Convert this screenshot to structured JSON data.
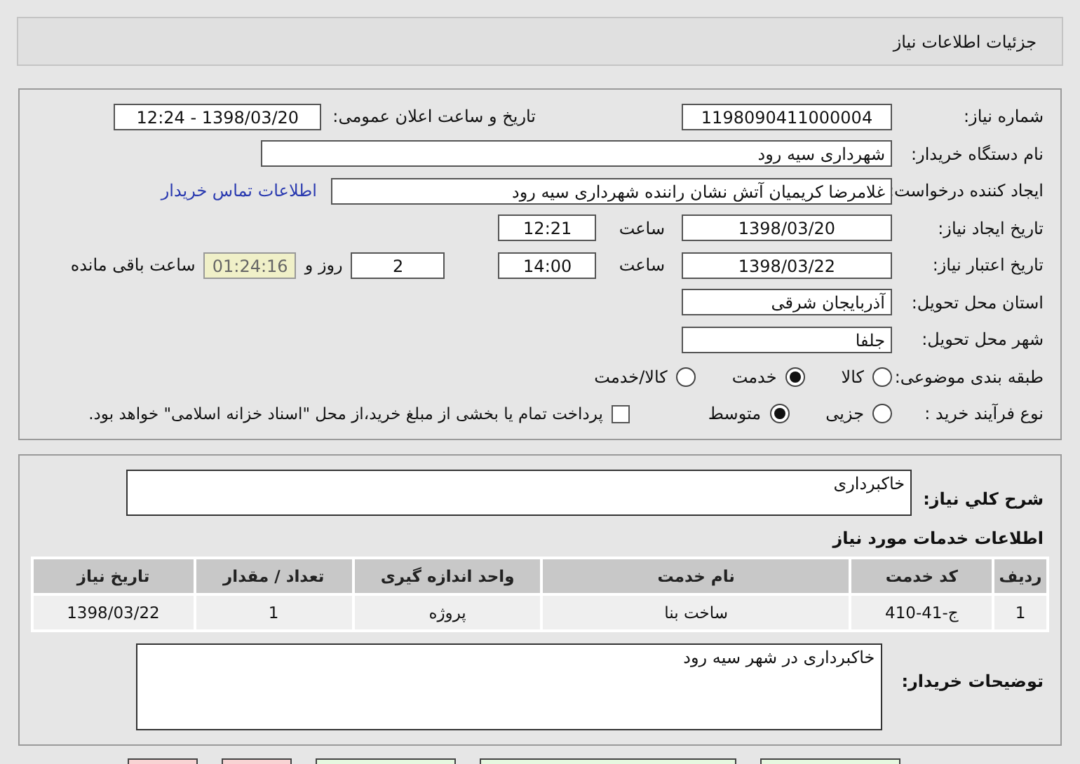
{
  "header": {
    "title": "جزئیات اطلاعات نیاز"
  },
  "need_info": {
    "need_number": {
      "label": "شماره نیاز:",
      "value": "1198090411000004"
    },
    "announce": {
      "label": "تاریخ و ساعت اعلان عمومی:",
      "value": "1398/03/20 - 12:24"
    },
    "buyer": {
      "label": "نام دستگاه خریدار:",
      "value": "شهرداری سیه رود"
    },
    "creator": {
      "label": "ایجاد کننده درخواست:",
      "value": "غلامرضا کریمیان آتش نشان راننده شهرداری سیه رود",
      "contact_link": "اطلاعات تماس خریدار"
    },
    "created": {
      "label": "تاریخ ایجاد نیاز:",
      "date": "1398/03/20",
      "time_label": "ساعت",
      "time": "12:21"
    },
    "validity": {
      "label": "تاریخ اعتبار نیاز:",
      "date": "1398/03/22",
      "time_label": "ساعت",
      "time": "14:00",
      "days": "2",
      "days_label": "روز و",
      "remaining": "01:24:16",
      "remaining_label": "ساعت باقی مانده"
    },
    "province": {
      "label": "استان محل تحویل:",
      "value": "آذربایجان شرقی"
    },
    "city": {
      "label": "شهر محل تحویل:",
      "value": "جلفا"
    },
    "category": {
      "label": "طبقه بندی موضوعی:",
      "options": [
        {
          "label": "کالا",
          "selected": false
        },
        {
          "label": "خدمت",
          "selected": true
        },
        {
          "label": "کالا/خدمت",
          "selected": false
        }
      ]
    },
    "process": {
      "label": "نوع فرآیند خرید :",
      "options": [
        {
          "label": "جزیی",
          "selected": false
        },
        {
          "label": "متوسط",
          "selected": true
        }
      ],
      "treasury": {
        "label": "پرداخت تمام یا بخشی از مبلغ خرید،از محل \"اسناد خزانه اسلامی\" خواهد بود.",
        "checked": false
      }
    }
  },
  "description": {
    "label": "شرح کلي نياز:",
    "value": "خاکبرداری"
  },
  "services": {
    "title": "اطلاعات خدمات مورد نیاز",
    "columns": [
      "ردیف",
      "کد خدمت",
      "نام خدمت",
      "واحد اندازه گیری",
      "تعداد / مقدار",
      "تاریخ نیاز"
    ],
    "rows": [
      [
        "1",
        "ج-41-410",
        "ساخت بنا",
        "پروژه",
        "1",
        "1398/03/22"
      ]
    ]
  },
  "buyer_notes": {
    "label": "توضیحات خریدار:",
    "value": "خاکبرداری در شهر سیه رود"
  },
  "buttons": [
    {
      "kind": "action"
    },
    {
      "kind": "wide"
    },
    {
      "kind": "action"
    },
    {
      "kind": "exit"
    },
    {
      "kind": "exit"
    }
  ]
}
